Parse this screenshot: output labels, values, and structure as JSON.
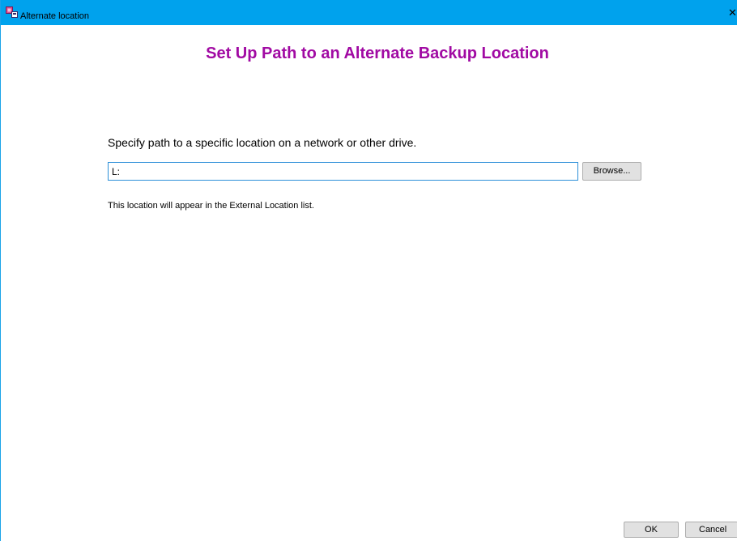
{
  "window": {
    "title": "Alternate location",
    "close_glyph": "✕",
    "app_icon": "backup-app-icon"
  },
  "main": {
    "heading": "Set Up Path to an Alternate Backup Location",
    "instruction": "Specify path to a specific location on a network or other drive.",
    "path_value": "L:",
    "browse_label": "Browse...",
    "note": "This location will appear in the External Location list."
  },
  "footer": {
    "ok_label": "OK",
    "cancel_label": "Cancel"
  },
  "colors": {
    "titlebar": "#00a2ed",
    "heading": "#a10aa3",
    "input_border": "#2c8fd8"
  }
}
